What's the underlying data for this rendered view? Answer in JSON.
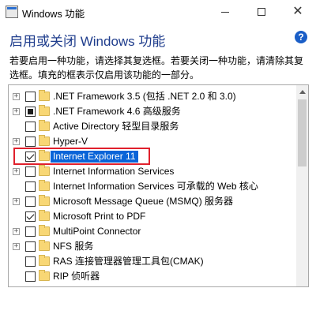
{
  "window": {
    "title": "Windows 功能",
    "minimize_label": "",
    "close_label": "✕"
  },
  "header": {
    "heading": "启用或关闭 Windows 功能",
    "help_label": "?",
    "description": "若要启用一种功能，请选择其复选框。若要关闭一种功能，请清除其复选框。填充的框表示仅启用该功能的一部分。"
  },
  "features": [
    {
      "label": ".NET Framework 3.5 (包括 .NET 2.0 和 3.0)",
      "expandable": true,
      "state": "unchecked"
    },
    {
      "label": ".NET Framework 4.6 高级服务",
      "expandable": true,
      "state": "partial"
    },
    {
      "label": "Active Directory 轻型目录服务",
      "expandable": false,
      "state": "unchecked"
    },
    {
      "label": "Hyper-V",
      "expandable": true,
      "state": "unchecked"
    },
    {
      "label": "Internet Explorer 11",
      "expandable": false,
      "state": "checked",
      "selected": true
    },
    {
      "label": "Internet Information Services",
      "expandable": true,
      "state": "unchecked"
    },
    {
      "label": "Internet Information Services 可承载的 Web 核心",
      "expandable": false,
      "state": "unchecked"
    },
    {
      "label": "Microsoft Message Queue (MSMQ) 服务器",
      "expandable": true,
      "state": "unchecked"
    },
    {
      "label": "Microsoft Print to PDF",
      "expandable": false,
      "state": "checked"
    },
    {
      "label": "MultiPoint Connector",
      "expandable": true,
      "state": "unchecked"
    },
    {
      "label": "NFS 服务",
      "expandable": true,
      "state": "unchecked"
    },
    {
      "label": "RAS 连接管理器管理工具包(CMAK)",
      "expandable": false,
      "state": "unchecked"
    },
    {
      "label": "RIP 侦听器",
      "expandable": false,
      "state": "unchecked"
    }
  ],
  "colors": {
    "heading": "#1e3c8c",
    "selection": "#0a64d8",
    "highlight_box": "#e0202c",
    "folder": "#f8d775"
  }
}
